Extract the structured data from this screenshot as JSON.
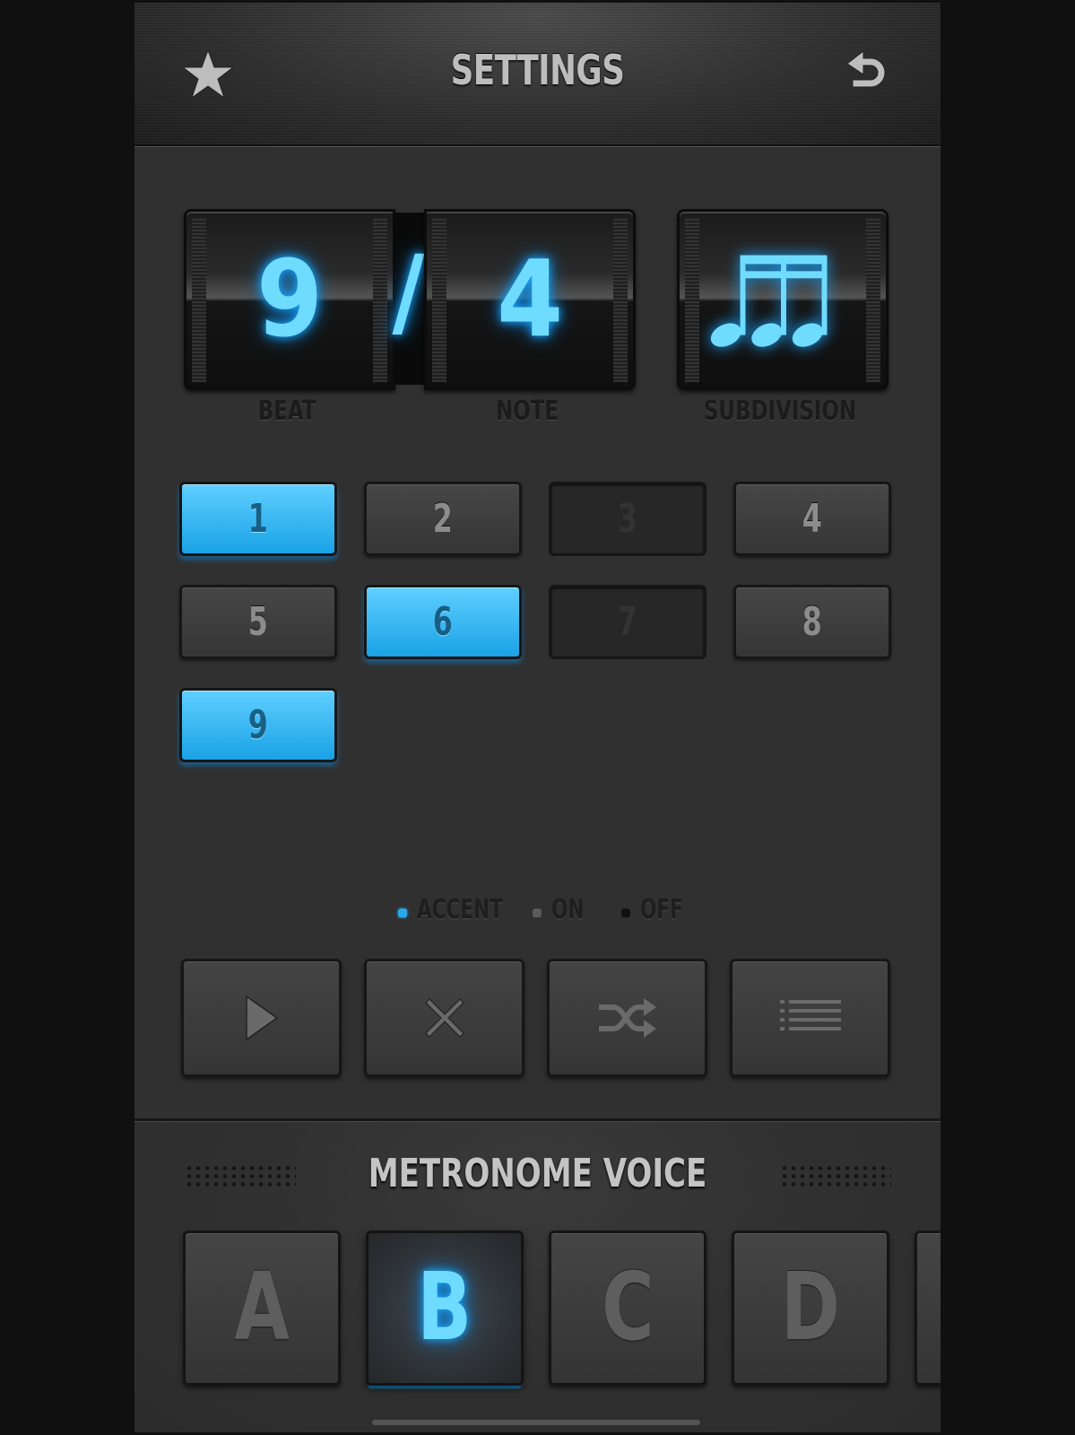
{
  "header": {
    "title": "SETTINGS",
    "left_icon": "star-icon",
    "right_icon": "undo-arrow-icon"
  },
  "time_signature": {
    "beat": "9",
    "separator": "/",
    "note": "4",
    "subdivision_icon": "sixteenth-notes-icon",
    "labels": {
      "beat": "BEAT",
      "note": "NOTE",
      "subdivision": "SUBDIVISION"
    }
  },
  "beats": [
    {
      "label": "1",
      "state": "accent"
    },
    {
      "label": "2",
      "state": "on"
    },
    {
      "label": "3",
      "state": "off"
    },
    {
      "label": "4",
      "state": "on"
    },
    {
      "label": "5",
      "state": "on"
    },
    {
      "label": "6",
      "state": "accent"
    },
    {
      "label": "7",
      "state": "off"
    },
    {
      "label": "8",
      "state": "on"
    },
    {
      "label": "9",
      "state": "accent"
    }
  ],
  "legend": {
    "accent": "ACCENT",
    "on": "ON",
    "off": "OFF"
  },
  "controls": [
    "play-icon",
    "close-icon",
    "shuffle-icon",
    "list-icon"
  ],
  "voice": {
    "title": "METRONOME VOICE",
    "options": [
      "A",
      "B",
      "C",
      "D"
    ],
    "selected": "B"
  },
  "colors": {
    "accent": "#1aa2e6",
    "glow": "#6fdcff",
    "background": "#303031"
  }
}
